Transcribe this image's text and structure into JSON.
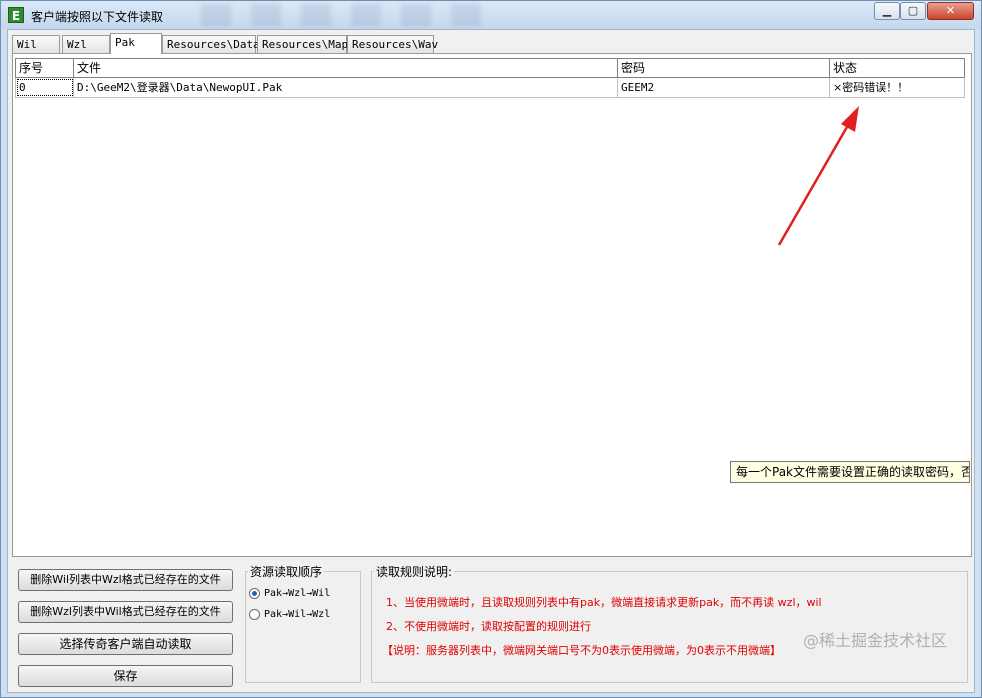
{
  "window": {
    "title": "客户端按照以下文件读取",
    "icon_letter": "E",
    "min_symbol": "▁",
    "max_symbol": "▢",
    "close_symbol": "✕"
  },
  "tabs": [
    {
      "label": "Wil"
    },
    {
      "label": "Wzl"
    },
    {
      "label": "Pak",
      "active": true
    },
    {
      "label": "Resources\\Data"
    },
    {
      "label": "Resources\\Map"
    },
    {
      "label": "Resources\\Wav"
    }
  ],
  "table": {
    "headers": [
      "序号",
      "文件",
      "密码",
      "状态"
    ],
    "rows": [
      [
        "0",
        "D:\\GeeM2\\登录器\\Data\\NewopUI.Pak",
        "GEEM2",
        "×密码错误！！"
      ]
    ]
  },
  "tooltip": "每一个Pak文件需要设置正确的读取密码，否则",
  "buttons": {
    "delete_wil": "删除Wil列表中Wzl格式已经存在的文件",
    "delete_wzl": "删除Wzl列表中Wil格式已经存在的文件",
    "select_client": "选择传奇客户端自动读取",
    "save": "保存"
  },
  "read_order": {
    "label": "资源读取顺序",
    "options": [
      {
        "label": "Pak→Wzl→Wil",
        "checked": true
      },
      {
        "label": "Pak→Wil→Wzl",
        "checked": false
      }
    ]
  },
  "rules": {
    "label": "读取规则说明:",
    "lines": [
      "1、当使用微端时，且读取规则列表中有pak，微端直接请求更新pak，而不再读 wzl，wil",
      "2、不使用微端时，读取按配置的规则进行",
      "【说明：服务器列表中，微端网关端口号不为0表示使用微端，为0表示不用微端】"
    ]
  },
  "watermark": "@稀土掘金技术社区",
  "colors": {
    "rule_text": "#e00000",
    "annotation_arrow": "#e02020",
    "tooltip_bg": "#ffffe1"
  }
}
